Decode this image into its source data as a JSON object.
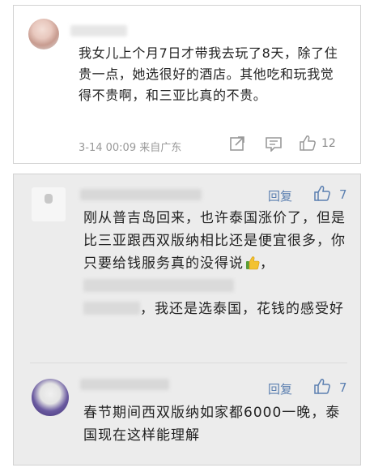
{
  "comment": {
    "text": "我女儿上个月7日才带我去玩了8天，除了住贵一点，她选很好的酒店。其他吃和玩我觉得不贵啊，和三亚比真的不贵。",
    "meta": "3-14 00:09 来自广东",
    "like_count": "12"
  },
  "replies": [
    {
      "reply_label": "回复",
      "like_count": "7",
      "text_part1": "刚从普吉岛回来，也许泰国涨价了，但是比三亚跟西双版纳相比还是便宜很多，你只要给钱服务真的没得说",
      "text_part2": "，",
      "text_part3": "，我还是选泰国，花钱的感受好"
    },
    {
      "reply_label": "回复",
      "like_count": "7",
      "text": "春节期间西双版纳如家都6000一晚，泰国现在这样能理解"
    }
  ],
  "colors": {
    "link_blue": "#5b7fb0",
    "meta_gray": "#999999",
    "reply_bg": "#ececec"
  },
  "icons": {
    "share": "share-icon",
    "chat": "comment-icon",
    "like": "thumbs-up-icon",
    "emoji": "thumbs-up-emoji-icon"
  }
}
